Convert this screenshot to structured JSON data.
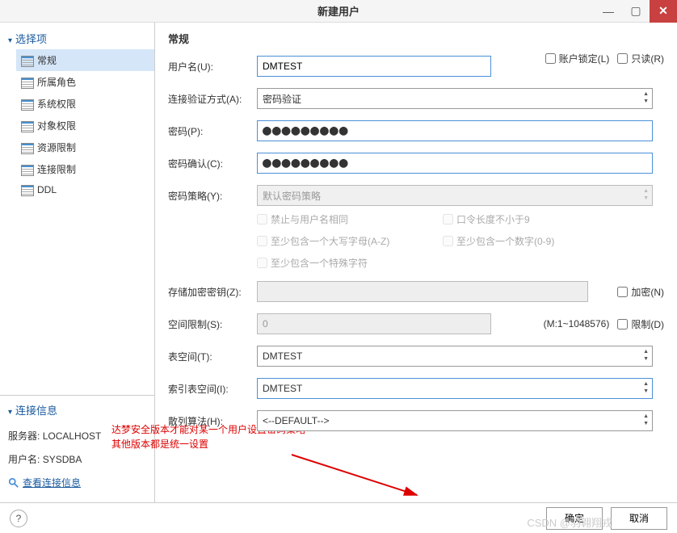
{
  "titlebar": {
    "title": "新建用户"
  },
  "sidebar": {
    "section": "选择项",
    "items": [
      {
        "label": "常规"
      },
      {
        "label": "所属角色"
      },
      {
        "label": "系统权限"
      },
      {
        "label": "对象权限"
      },
      {
        "label": "资源限制"
      },
      {
        "label": "连接限制"
      },
      {
        "label": "DDL"
      }
    ],
    "conn_section": "连接信息",
    "conn": {
      "server_label": "服务器:",
      "server_value": "LOCALHOST",
      "user_label": "用户名:",
      "user_value": "SYSDBA",
      "view_link": "查看连接信息"
    }
  },
  "content": {
    "heading": "常规",
    "username_label": "用户名(U):",
    "username_value": "DMTEST",
    "account_locked_label": "账户锁定(L)",
    "readonly_label": "只读(R)",
    "auth_label": "连接验证方式(A):",
    "auth_value": "密码验证",
    "password_label": "密码(P):",
    "password_value": "●●●●●●●●●",
    "password_confirm_label": "密码确认(C):",
    "password_confirm_value": "●●●●●●●●●",
    "policy_label": "密码策略(Y):",
    "policy_value": "默认密码策略",
    "policy_opts": {
      "opt1": "禁止与用户名相同",
      "opt2": "口令长度不小于9",
      "opt3": "至少包含一个大写字母(A-Z)",
      "opt4": "至少包含一个数字(0-9)",
      "opt5": "至少包含一个特殊字符"
    },
    "encrypt_key_label": "存储加密密钥(Z):",
    "encrypt_checkbox_label": "加密(N)",
    "space_limit_label": "空间限制(S):",
    "space_limit_value": "0",
    "space_limit_range": "(M:1~1048576)",
    "limit_checkbox_label": "限制(D)",
    "tablespace_label": "表空间(T):",
    "tablespace_value": "DMTEST",
    "index_ts_label": "索引表空间(I):",
    "index_ts_value": "DMTEST",
    "hash_label": "散列算法(H):",
    "hash_value": "<--DEFAULT-->",
    "annotation_line1": "达梦安全版本才能对某一个用户设置密码策略",
    "annotation_line2": "其他版本都是统一设置"
  },
  "footer": {
    "ok": "确定",
    "cancel": "取消"
  },
  "watermark": "CSDN @羽翱翔戎"
}
